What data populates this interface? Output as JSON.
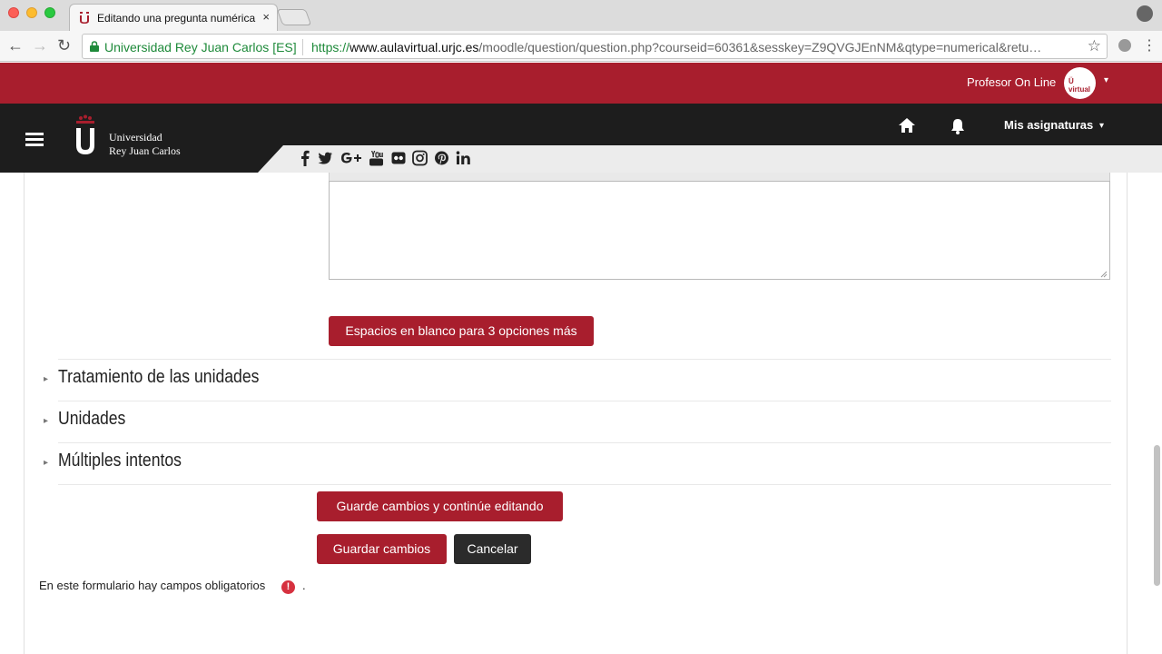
{
  "browser": {
    "tab_title": "Editando una pregunta numérica",
    "tab_close": "×",
    "site_name": "Universidad Rey Juan Carlos [ES]",
    "url_prefix": "https://",
    "url_host": "www.aulavirtual.urjc.es",
    "url_path": "/moodle/question/question.php?courseid=60361&sesskey=Z9QVGJEnNM&qtype=numerical&retu…",
    "back": "←",
    "forward": "→",
    "reload": "↻",
    "star": "☆",
    "menu": "⋮"
  },
  "topbar": {
    "user_name": "Profesor On Line",
    "avatar_text": "Ü virtual",
    "caret": "▾",
    "bg_color": "#a81e2d"
  },
  "navbar": {
    "logo_line1": "Universidad",
    "logo_line2": "Rey Juan Carlos",
    "courses_label": "Mis asignaturas",
    "caret": "▾",
    "icons": [
      "home-icon",
      "bell-icon"
    ],
    "social_icons": [
      "facebook-icon",
      "twitter-icon",
      "google-plus-icon",
      "youtube-icon",
      "flickr-icon",
      "instagram-icon",
      "pinterest-icon",
      "linkedin-icon"
    ]
  },
  "form": {
    "blanks_button": "Espacios en blanco para 3 opciones más",
    "sections": [
      {
        "arrow": "▸",
        "title": "Tratamiento de las unidades"
      },
      {
        "arrow": "▸",
        "title": "Unidades"
      },
      {
        "arrow": "▸",
        "title": "Múltiples intentos"
      }
    ],
    "save_continue": "Guarde cambios y continúe editando",
    "save": "Guardar cambios",
    "cancel": "Cancelar",
    "required_note": "En este formulario hay campos obligatorios",
    "required_icon": "!",
    "required_dot": "."
  }
}
